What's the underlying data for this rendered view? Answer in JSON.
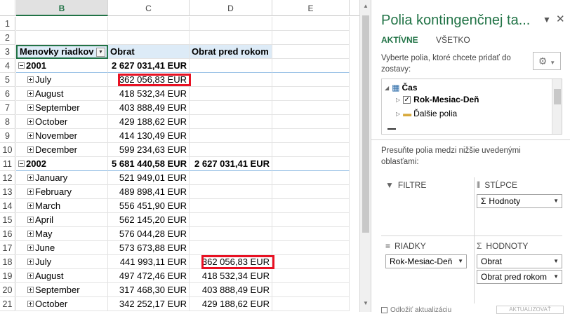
{
  "columns": [
    "B",
    "C",
    "D",
    "E"
  ],
  "pivot": {
    "header": {
      "row_num": "3",
      "label": "Menovky riadkov",
      "c": "Obrat",
      "d": "Obrat pred rokom"
    },
    "rows": [
      {
        "num": "4",
        "label": "2001",
        "type": "year",
        "c": "2 627 031,41 EUR",
        "d": ""
      },
      {
        "num": "5",
        "label": "July",
        "type": "month",
        "c": "362 056,83 EUR",
        "d": ""
      },
      {
        "num": "6",
        "label": "August",
        "type": "month",
        "c": "418 532,34 EUR",
        "d": ""
      },
      {
        "num": "7",
        "label": "September",
        "type": "month",
        "c": "403 888,49 EUR",
        "d": ""
      },
      {
        "num": "8",
        "label": "October",
        "type": "month",
        "c": "429 188,62 EUR",
        "d": ""
      },
      {
        "num": "9",
        "label": "November",
        "type": "month",
        "c": "414 130,49 EUR",
        "d": ""
      },
      {
        "num": "10",
        "label": "December",
        "type": "month",
        "c": "599 234,63 EUR",
        "d": ""
      },
      {
        "num": "11",
        "label": "2002",
        "type": "year",
        "c": "5 681 440,58 EUR",
        "d": "2 627 031,41 EUR"
      },
      {
        "num": "12",
        "label": "January",
        "type": "month",
        "c": "521 949,01 EUR",
        "d": ""
      },
      {
        "num": "13",
        "label": "February",
        "type": "month",
        "c": "489 898,41 EUR",
        "d": ""
      },
      {
        "num": "14",
        "label": "March",
        "type": "month",
        "c": "556 451,90 EUR",
        "d": ""
      },
      {
        "num": "15",
        "label": "April",
        "type": "month",
        "c": "562 145,20 EUR",
        "d": ""
      },
      {
        "num": "16",
        "label": "May",
        "type": "month",
        "c": "576 044,28 EUR",
        "d": ""
      },
      {
        "num": "17",
        "label": "June",
        "type": "month",
        "c": "573 673,88 EUR",
        "d": ""
      },
      {
        "num": "18",
        "label": "July",
        "type": "month",
        "c": "441 993,11 EUR",
        "d": "362 056,83 EUR"
      },
      {
        "num": "19",
        "label": "August",
        "type": "month",
        "c": "497 472,46 EUR",
        "d": "418 532,34 EUR"
      },
      {
        "num": "20",
        "label": "September",
        "type": "month",
        "c": "317 468,30 EUR",
        "d": "403 888,49 EUR"
      },
      {
        "num": "21",
        "label": "October",
        "type": "month",
        "c": "342 252,17 EUR",
        "d": "429 188,62 EUR"
      }
    ],
    "highlight_color": "#e81123"
  },
  "pane": {
    "title": "Polia kontingenčnej ta...",
    "tabs": {
      "active": "AKTÍVNE",
      "all": "VŠETKO"
    },
    "hint": "Vyberte polia, ktoré chcete pridať do zostavy:",
    "field_group": "Čas",
    "field_checked": "Rok-Mesiac-Deň",
    "more_fields": "Ďalšie polia",
    "move_hint": "Presuňte polia medzi nižšie uvedenými oblasťami:",
    "areas": {
      "filters": "FILTRE",
      "columns": "STĹPCE",
      "rows": "RIADKY",
      "values": "HODNOTY"
    },
    "columns_chip": "Hodnoty",
    "rows_chip": "Rok-Mesiac-Deň",
    "values_chips": [
      "Obrat",
      "Obrat pred rokom"
    ],
    "bottom_label": "Odložiť aktualizáciu",
    "defer_button": "AKTUALIZOVAŤ"
  },
  "accent": "#217346"
}
